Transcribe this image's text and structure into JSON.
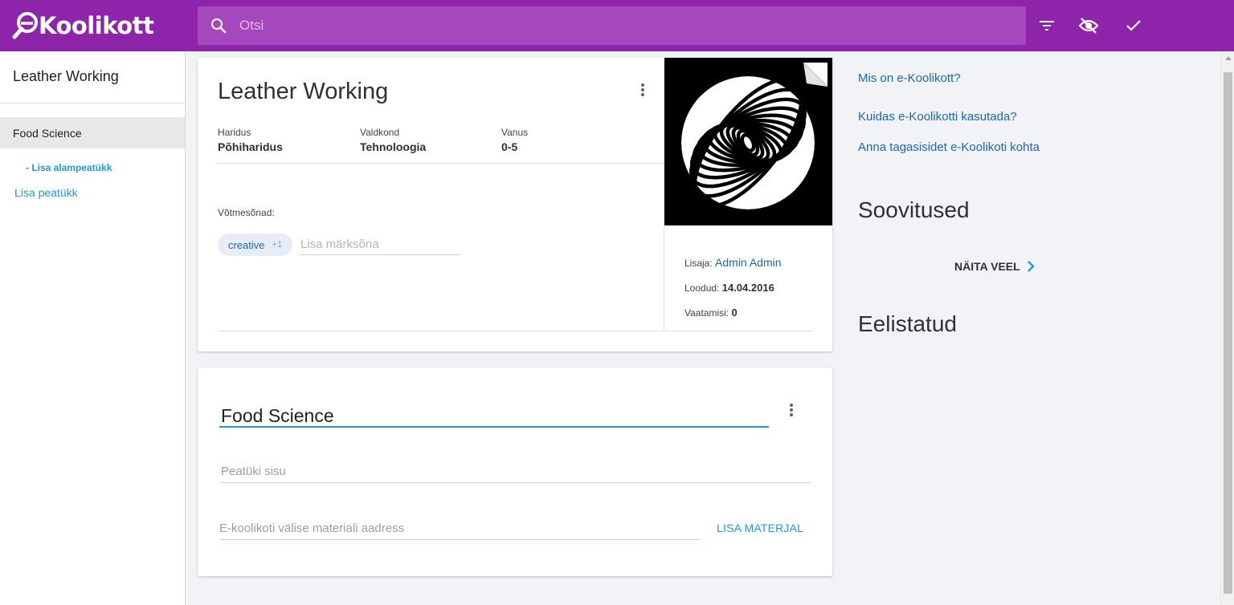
{
  "header": {
    "logo_text": "Koolikott",
    "search_placeholder": "Otsi"
  },
  "sidebar": {
    "title": "Leather Working",
    "chapters": [
      {
        "label": "Food Science",
        "active": true
      }
    ],
    "add_subchapter": "- Lisa alampeatükk",
    "add_chapter": "Lisa peatükk"
  },
  "material": {
    "title": "Leather Working",
    "meta": [
      {
        "label": "Haridus",
        "value": "Põhiharidus"
      },
      {
        "label": "Valdkond",
        "value": "Tehnoloogia"
      },
      {
        "label": "Vanus",
        "value": "0-5"
      }
    ],
    "keywords_label": "Võtmesõnad:",
    "keyword_chip": "creative",
    "keyword_chip_count": "+1",
    "keyword_placeholder": "Lisa märksõna",
    "added_by_label": "Lisaja:",
    "added_by": "Admin Admin",
    "created_label": "Loodud:",
    "created": "14.04.2016",
    "views_label": "Vaatamisi:",
    "views": "0"
  },
  "chapter": {
    "title": "Food Science",
    "content_placeholder": "Peatüki sisu",
    "url_placeholder": "E-koolikoti välise materiali aadress",
    "add_material": "LISA MATERJAL"
  },
  "right": {
    "links": [
      "Mis on e-Koolikott?",
      "Kuidas e-Koolikotti kasutada?",
      "Anna tagasisidet e-Koolikoti kohta"
    ],
    "recommendations_title": "Soovitused",
    "show_more": "NÄITA VEEL",
    "favorites_title": "Eelistatud"
  },
  "colors": {
    "header": "#8e24aa",
    "accent": "#1e9ad6",
    "link": "#1e66b5"
  }
}
